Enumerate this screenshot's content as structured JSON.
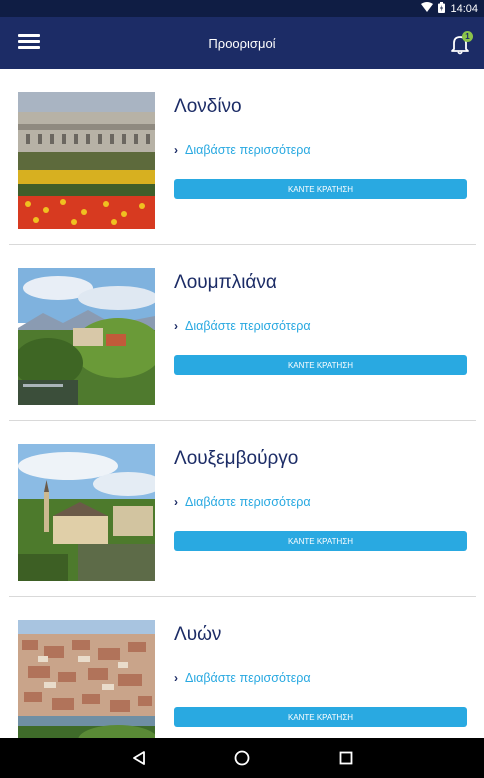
{
  "status_bar": {
    "time": "14:04",
    "icons": [
      "wifi-icon",
      "battery-icon"
    ]
  },
  "app_bar": {
    "title": "Προορισμοί",
    "notification_count": "1",
    "icons": [
      "menu-icon",
      "bell-icon"
    ]
  },
  "destinations": [
    {
      "city": "Λονδίνο",
      "read_more": "Διαβάστε περισσότερα",
      "book": "ΚΑΝΤΕ ΚΡΑΤΗΣΗ"
    },
    {
      "city": "Λουμπλιάνα",
      "read_more": "Διαβάστε περισσότερα",
      "book": "ΚΑΝΤΕ ΚΡΑΤΗΣΗ"
    },
    {
      "city": "Λουξεμβούργο",
      "read_more": "Διαβάστε περισσότερα",
      "book": "ΚΑΝΤΕ ΚΡΑΤΗΣΗ"
    },
    {
      "city": "Λυών",
      "read_more": "Διαβάστε περισσότερα",
      "book": "ΚΑΝΤΕ ΚΡΑΤΗΣΗ"
    }
  ],
  "nav_bar": {
    "icons": [
      "back-icon",
      "home-icon",
      "recents-icon"
    ]
  },
  "colors": {
    "app_bar": "#1c2c66",
    "status_bar": "#0f1d44",
    "accent": "#29a9e1",
    "badge": "#8bc34a"
  }
}
